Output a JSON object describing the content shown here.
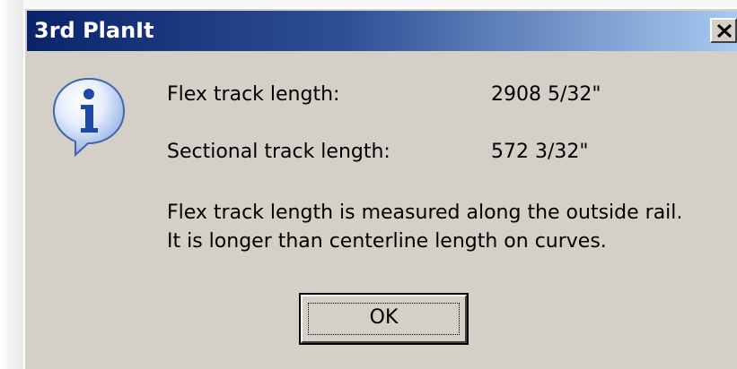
{
  "dialog": {
    "title": "3rd PlanIt",
    "icon": "info-icon",
    "close_icon": "close-icon"
  },
  "rows": [
    {
      "label": "Flex track length:",
      "value": "2908 5/32\""
    },
    {
      "label": "Sectional track length:",
      "value": "572 3/32\""
    }
  ],
  "note": {
    "line1": "Flex track length is measured along the outside rail.",
    "line2": "It is longer than centerline length on curves."
  },
  "buttons": {
    "ok_label": "OK"
  },
  "colors": {
    "dialog_bg": "#d4d0c8",
    "title_start": "#0a246a",
    "title_end": "#a6caf0",
    "title_text": "#ffffff"
  }
}
